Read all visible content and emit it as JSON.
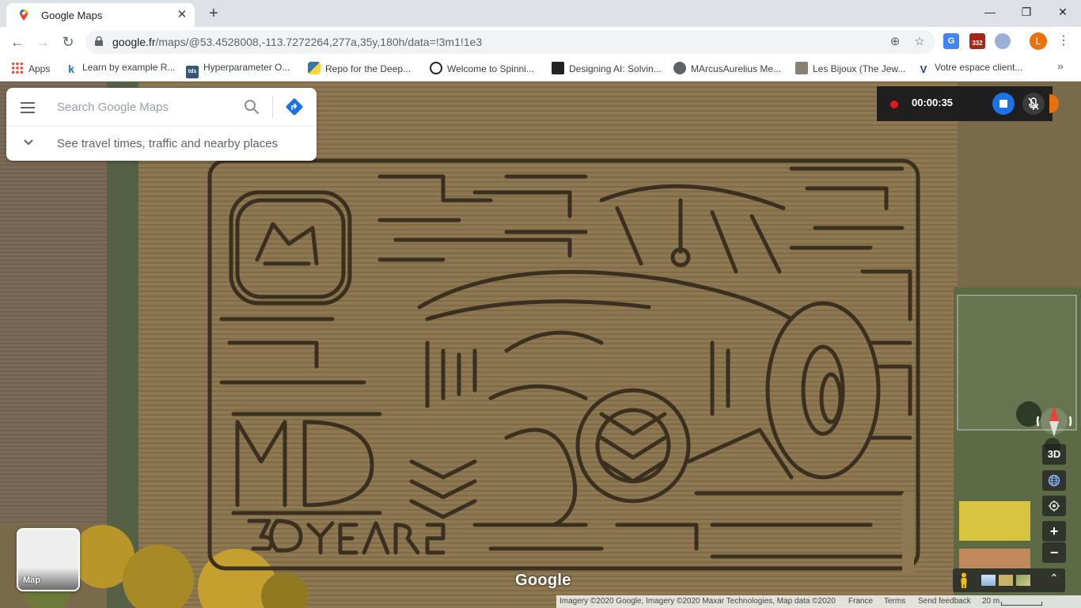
{
  "tab": {
    "title": "Google Maps",
    "close": "✕",
    "new_tab": "+"
  },
  "window": {
    "minimize": "—",
    "restore": "❐",
    "close": "✕"
  },
  "toolbar": {
    "url_host": "google.fr",
    "url_rest": "/maps/@53.4528008,-113.7272264,277a,35y,180h/data=!3m1!1e3",
    "avatar_letter": "L",
    "badge_count": "332"
  },
  "bookmarks": [
    {
      "label": "Apps",
      "icon": "apps-grid-icon"
    },
    {
      "label": "Learn by example R...",
      "icon": "k-icon"
    },
    {
      "label": "Hyperparameter O...",
      "icon": "tds-icon"
    },
    {
      "label": "Repo for the Deep...",
      "icon": "python-icon"
    },
    {
      "label": "Welcome to Spinni...",
      "icon": "openai-icon"
    },
    {
      "label": "Designing AI: Solvin...",
      "icon": "book-icon"
    },
    {
      "label": "MArcusAurelius Me...",
      "icon": "globe-icon"
    },
    {
      "label": "Les Bijoux (The Jew...",
      "icon": "portrait-icon"
    },
    {
      "label": "Votre espace client...",
      "icon": "brand-icon"
    }
  ],
  "search": {
    "placeholder": "Search Google Maps",
    "hint": "See travel times, traffic and nearby places"
  },
  "recorder": {
    "time": "00:00:35"
  },
  "controls": {
    "three_d": "3D",
    "zoom_in": "+",
    "zoom_out": "−"
  },
  "layer": {
    "label": "Map"
  },
  "logo": "Google",
  "attribution": {
    "imagery": "Imagery ©2020 Google, Imagery ©2020 Maxar Technologies, Map data ©2020",
    "country": "France",
    "terms": "Terms",
    "feedback": "Send feedback",
    "scale": "20 m"
  },
  "colors": {
    "accent": "#1a73e8",
    "recording": "#e8151b",
    "avatar": "#e8710a",
    "field": "#8a7652"
  }
}
